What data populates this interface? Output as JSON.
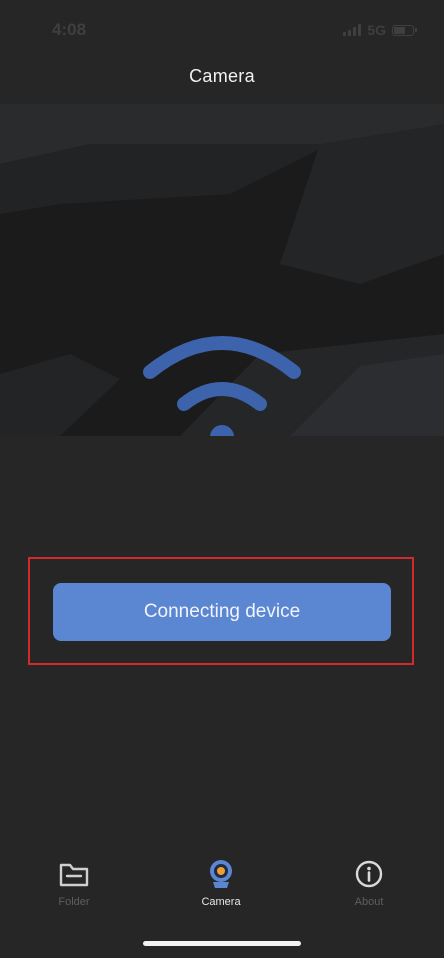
{
  "status_bar": {
    "time": "4:08",
    "network": "5G",
    "signal_icon": "signal-bars-icon",
    "battery_icon": "battery-icon"
  },
  "header": {
    "title": "Camera"
  },
  "hero": {
    "icon": "wifi-icon",
    "icon_color": "#3d63ad"
  },
  "connect": {
    "button_label": "Connecting device",
    "button_color": "#5b86d1",
    "highlight_color": "#d22a2a"
  },
  "tabs": [
    {
      "label": "Folder",
      "icon": "folder-icon",
      "active": false
    },
    {
      "label": "Camera",
      "icon": "camera-icon",
      "active": true
    },
    {
      "label": "About",
      "icon": "info-icon",
      "active": false
    }
  ],
  "colors": {
    "background": "#262626",
    "tab_active": "#e6e6e6",
    "tab_inactive": "#5e5e5e"
  }
}
